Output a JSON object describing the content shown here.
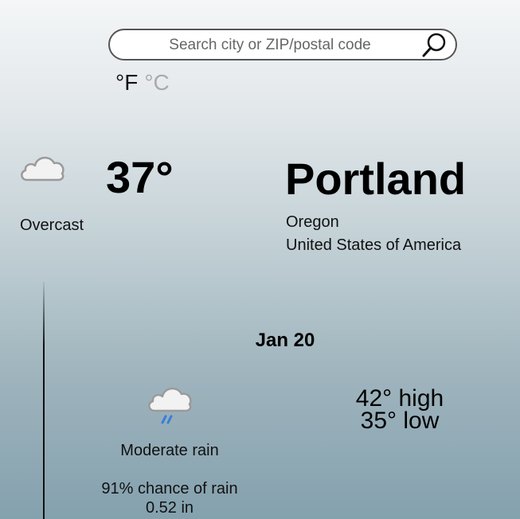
{
  "search": {
    "placeholder": "Search city or ZIP/postal code",
    "icon": "search-icon"
  },
  "units": {
    "fahrenheit": "°F",
    "celsius": "°C",
    "selected": "fahrenheit"
  },
  "current": {
    "icon": "cloud-icon",
    "condition": "Overcast",
    "temperature": "37°"
  },
  "location": {
    "city": "Portland",
    "region": "Oregon",
    "country": "United States of America"
  },
  "forecast": {
    "date": "Jan 20",
    "icon": "rain-cloud-icon",
    "condition": "Moderate rain",
    "rain_chance": "91% chance of rain",
    "rain_amount": "0.52 in",
    "high": "42° high",
    "low": "35° low"
  },
  "colors": {
    "rain_drops": "#3a7dd8",
    "cloud_fill": "#f2f2f2",
    "cloud_stroke": "#9a9a9a"
  }
}
